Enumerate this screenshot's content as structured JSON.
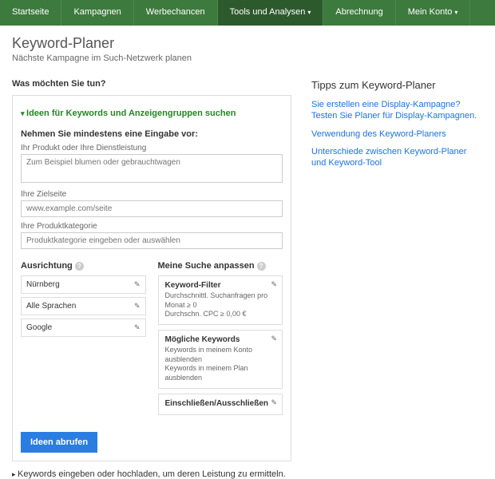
{
  "nav": {
    "items": [
      "Startseite",
      "Kampagnen",
      "Werbechancen",
      "Tools und Analysen",
      "Abrechnung",
      "Mein Konto"
    ],
    "active_index": 3,
    "dropdown_indices": [
      3,
      5
    ]
  },
  "header": {
    "title": "Keyword-Planer",
    "subtitle": "Nächste Kampagne im Such-Netzwerk planen"
  },
  "question": "Was möchten Sie tun?",
  "panel": {
    "expand_title": "Ideen für Keywords und Anzeigengruppen suchen",
    "instruction": "Nehmen Sie mindestens eine Eingabe vor:",
    "fields": {
      "product_label": "Ihr Produkt oder Ihre Dienstleistung",
      "product_placeholder": "Zum Beispiel blumen oder gebrauchtwagen",
      "landing_label": "Ihre Zielseite",
      "landing_placeholder": "www.example.com/seite",
      "category_label": "Ihre Produktkategorie",
      "category_placeholder": "Produktkategorie eingeben oder auswählen"
    },
    "targeting": {
      "heading": "Ausrichtung",
      "rows": [
        "Nürnberg",
        "Alle Sprachen",
        "Google"
      ]
    },
    "customize": {
      "heading": "Meine Suche anpassen",
      "filter": {
        "title": "Keyword-Filter",
        "line1": "Durchschnittl. Suchanfragen pro Monat ≥ 0",
        "line2": "Durchschn. CPC ≥ 0,00 €"
      },
      "possible": {
        "title": "Mögliche Keywords",
        "line1": "Keywords in meinem Konto ausblenden",
        "line2": "Keywords in meinem Plan ausblenden"
      },
      "include_exclude": "Einschließen/Ausschließen"
    },
    "button": "Ideen abrufen",
    "collapsed_row": "Keywords eingeben oder hochladen, um deren Leistung zu ermitteln."
  },
  "tips": {
    "heading": "Tipps zum Keyword-Planer",
    "links": [
      "Sie erstellen eine Display-Kampagne? Testen Sie Planer für Display-Kampagnen.",
      "Verwendung des Keyword-Planers",
      "Unterschiede zwischen Keyword-Planer und Keyword-Tool"
    ]
  }
}
